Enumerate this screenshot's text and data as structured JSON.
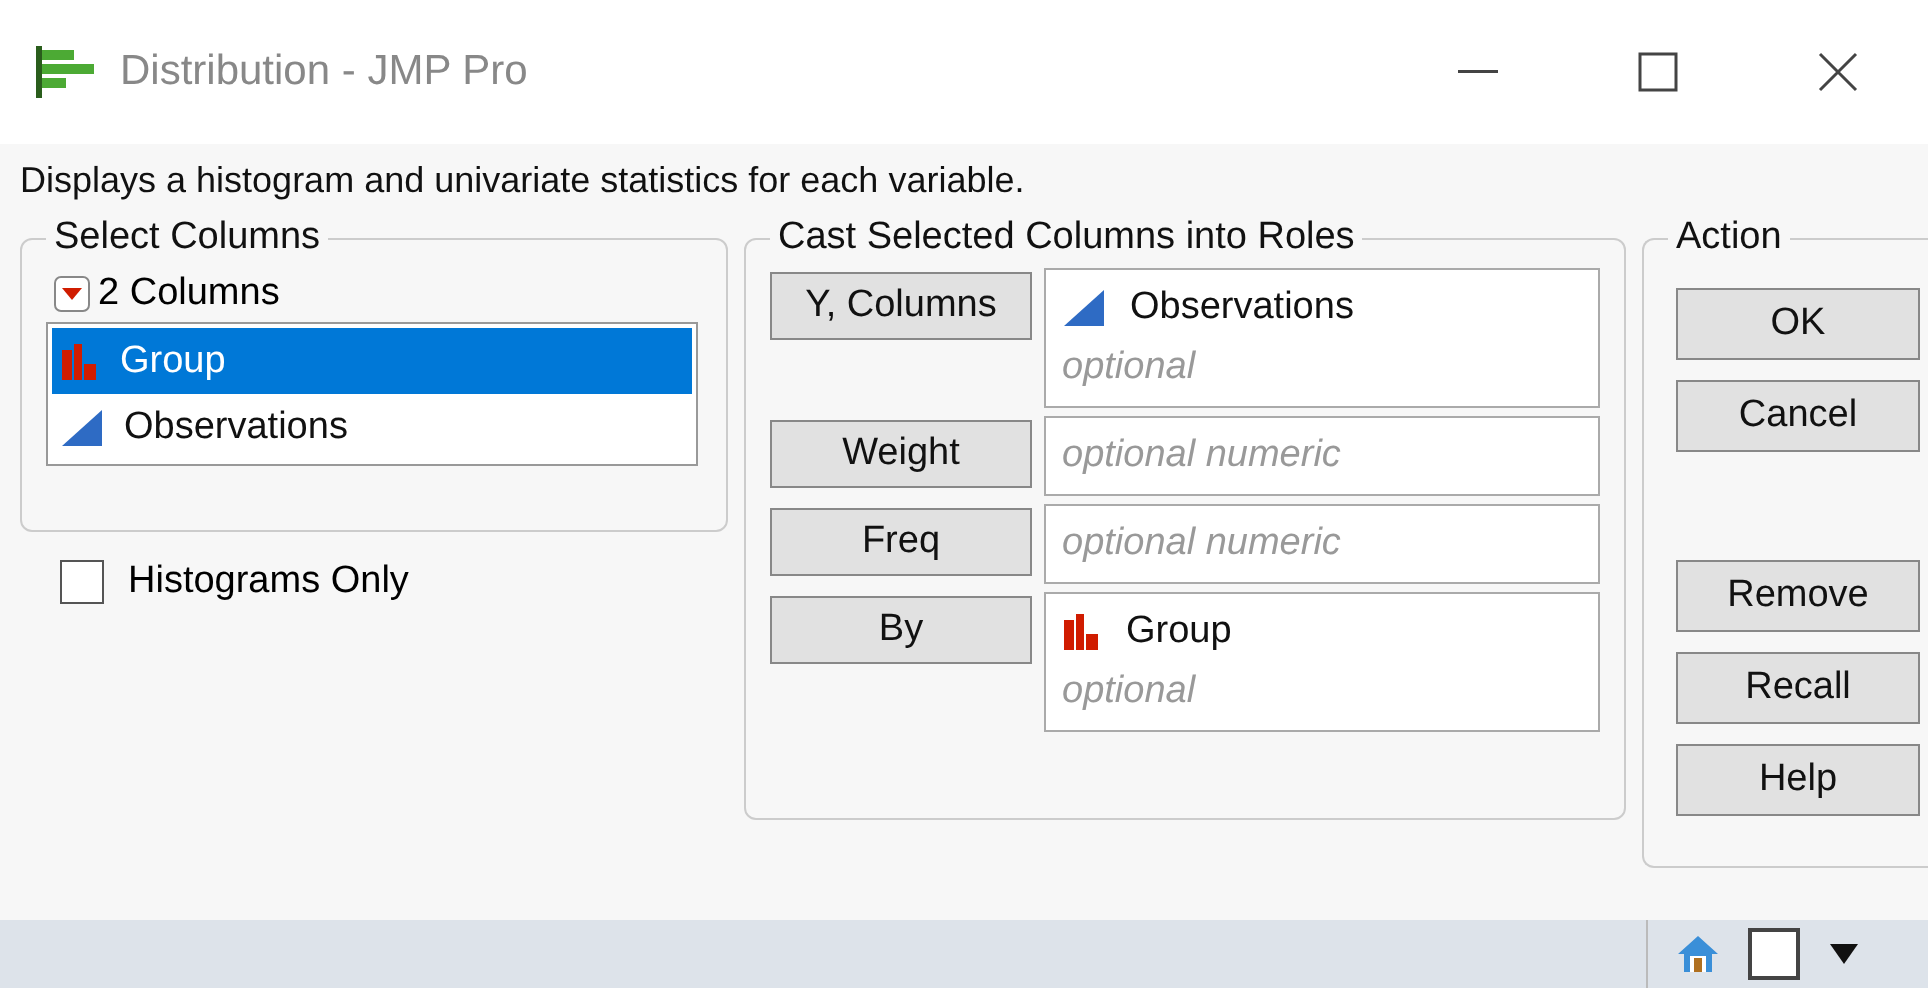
{
  "window": {
    "title": "Distribution - JMP Pro"
  },
  "description": "Displays a histogram and univariate statistics for each variable.",
  "select_columns": {
    "title": "Select Columns",
    "count_label": "2 Columns",
    "columns": [
      {
        "name": "Group",
        "kind": "nominal",
        "selected": true
      },
      {
        "name": "Observations",
        "kind": "continuous",
        "selected": false
      }
    ]
  },
  "histograms_only": {
    "label": "Histograms Only",
    "checked": false
  },
  "roles": {
    "title": "Cast Selected Columns into Roles",
    "items": [
      {
        "button": "Y, Columns",
        "columns": [
          {
            "name": "Observations",
            "kind": "continuous"
          }
        ],
        "placeholder": "optional"
      },
      {
        "button": "Weight",
        "placeholder": "optional numeric"
      },
      {
        "button": "Freq",
        "placeholder": "optional numeric"
      },
      {
        "button": "By",
        "columns": [
          {
            "name": "Group",
            "kind": "nominal"
          }
        ],
        "placeholder": "optional"
      }
    ]
  },
  "action": {
    "title": "Action",
    "buttons": [
      {
        "label": "OK"
      },
      {
        "label": "Cancel"
      }
    ],
    "more_buttons": [
      {
        "label": "Remove"
      },
      {
        "label": "Recall"
      },
      {
        "label": "Help"
      }
    ]
  }
}
